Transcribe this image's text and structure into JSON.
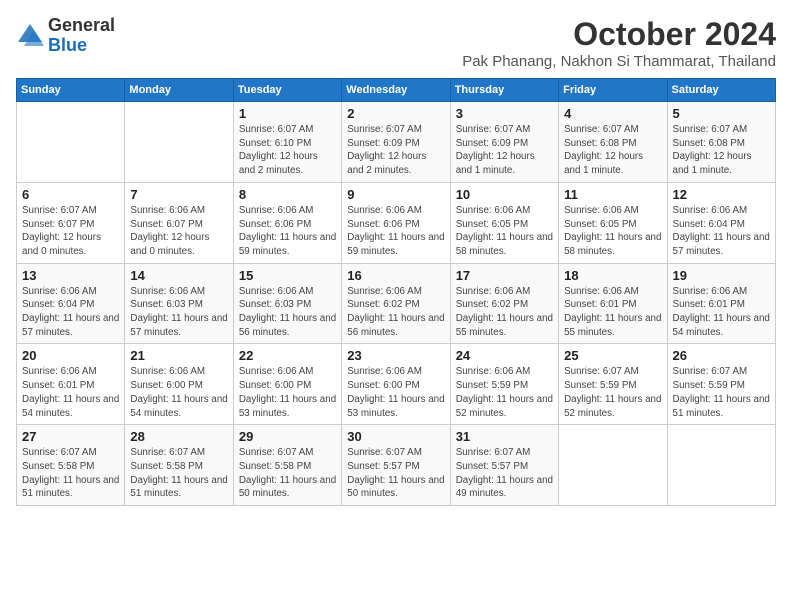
{
  "logo": {
    "general": "General",
    "blue": "Blue"
  },
  "header": {
    "title": "October 2024",
    "subtitle": "Pak Phanang, Nakhon Si Thammarat, Thailand"
  },
  "weekdays": [
    "Sunday",
    "Monday",
    "Tuesday",
    "Wednesday",
    "Thursday",
    "Friday",
    "Saturday"
  ],
  "weeks": [
    [
      {
        "day": "",
        "detail": ""
      },
      {
        "day": "",
        "detail": ""
      },
      {
        "day": "1",
        "detail": "Sunrise: 6:07 AM\nSunset: 6:10 PM\nDaylight: 12 hours and 2 minutes."
      },
      {
        "day": "2",
        "detail": "Sunrise: 6:07 AM\nSunset: 6:09 PM\nDaylight: 12 hours and 2 minutes."
      },
      {
        "day": "3",
        "detail": "Sunrise: 6:07 AM\nSunset: 6:09 PM\nDaylight: 12 hours and 1 minute."
      },
      {
        "day": "4",
        "detail": "Sunrise: 6:07 AM\nSunset: 6:08 PM\nDaylight: 12 hours and 1 minute."
      },
      {
        "day": "5",
        "detail": "Sunrise: 6:07 AM\nSunset: 6:08 PM\nDaylight: 12 hours and 1 minute."
      }
    ],
    [
      {
        "day": "6",
        "detail": "Sunrise: 6:07 AM\nSunset: 6:07 PM\nDaylight: 12 hours and 0 minutes."
      },
      {
        "day": "7",
        "detail": "Sunrise: 6:06 AM\nSunset: 6:07 PM\nDaylight: 12 hours and 0 minutes."
      },
      {
        "day": "8",
        "detail": "Sunrise: 6:06 AM\nSunset: 6:06 PM\nDaylight: 11 hours and 59 minutes."
      },
      {
        "day": "9",
        "detail": "Sunrise: 6:06 AM\nSunset: 6:06 PM\nDaylight: 11 hours and 59 minutes."
      },
      {
        "day": "10",
        "detail": "Sunrise: 6:06 AM\nSunset: 6:05 PM\nDaylight: 11 hours and 58 minutes."
      },
      {
        "day": "11",
        "detail": "Sunrise: 6:06 AM\nSunset: 6:05 PM\nDaylight: 11 hours and 58 minutes."
      },
      {
        "day": "12",
        "detail": "Sunrise: 6:06 AM\nSunset: 6:04 PM\nDaylight: 11 hours and 57 minutes."
      }
    ],
    [
      {
        "day": "13",
        "detail": "Sunrise: 6:06 AM\nSunset: 6:04 PM\nDaylight: 11 hours and 57 minutes."
      },
      {
        "day": "14",
        "detail": "Sunrise: 6:06 AM\nSunset: 6:03 PM\nDaylight: 11 hours and 57 minutes."
      },
      {
        "day": "15",
        "detail": "Sunrise: 6:06 AM\nSunset: 6:03 PM\nDaylight: 11 hours and 56 minutes."
      },
      {
        "day": "16",
        "detail": "Sunrise: 6:06 AM\nSunset: 6:02 PM\nDaylight: 11 hours and 56 minutes."
      },
      {
        "day": "17",
        "detail": "Sunrise: 6:06 AM\nSunset: 6:02 PM\nDaylight: 11 hours and 55 minutes."
      },
      {
        "day": "18",
        "detail": "Sunrise: 6:06 AM\nSunset: 6:01 PM\nDaylight: 11 hours and 55 minutes."
      },
      {
        "day": "19",
        "detail": "Sunrise: 6:06 AM\nSunset: 6:01 PM\nDaylight: 11 hours and 54 minutes."
      }
    ],
    [
      {
        "day": "20",
        "detail": "Sunrise: 6:06 AM\nSunset: 6:01 PM\nDaylight: 11 hours and 54 minutes."
      },
      {
        "day": "21",
        "detail": "Sunrise: 6:06 AM\nSunset: 6:00 PM\nDaylight: 11 hours and 54 minutes."
      },
      {
        "day": "22",
        "detail": "Sunrise: 6:06 AM\nSunset: 6:00 PM\nDaylight: 11 hours and 53 minutes."
      },
      {
        "day": "23",
        "detail": "Sunrise: 6:06 AM\nSunset: 6:00 PM\nDaylight: 11 hours and 53 minutes."
      },
      {
        "day": "24",
        "detail": "Sunrise: 6:06 AM\nSunset: 5:59 PM\nDaylight: 11 hours and 52 minutes."
      },
      {
        "day": "25",
        "detail": "Sunrise: 6:07 AM\nSunset: 5:59 PM\nDaylight: 11 hours and 52 minutes."
      },
      {
        "day": "26",
        "detail": "Sunrise: 6:07 AM\nSunset: 5:59 PM\nDaylight: 11 hours and 51 minutes."
      }
    ],
    [
      {
        "day": "27",
        "detail": "Sunrise: 6:07 AM\nSunset: 5:58 PM\nDaylight: 11 hours and 51 minutes."
      },
      {
        "day": "28",
        "detail": "Sunrise: 6:07 AM\nSunset: 5:58 PM\nDaylight: 11 hours and 51 minutes."
      },
      {
        "day": "29",
        "detail": "Sunrise: 6:07 AM\nSunset: 5:58 PM\nDaylight: 11 hours and 50 minutes."
      },
      {
        "day": "30",
        "detail": "Sunrise: 6:07 AM\nSunset: 5:57 PM\nDaylight: 11 hours and 50 minutes."
      },
      {
        "day": "31",
        "detail": "Sunrise: 6:07 AM\nSunset: 5:57 PM\nDaylight: 11 hours and 49 minutes."
      },
      {
        "day": "",
        "detail": ""
      },
      {
        "day": "",
        "detail": ""
      }
    ]
  ]
}
